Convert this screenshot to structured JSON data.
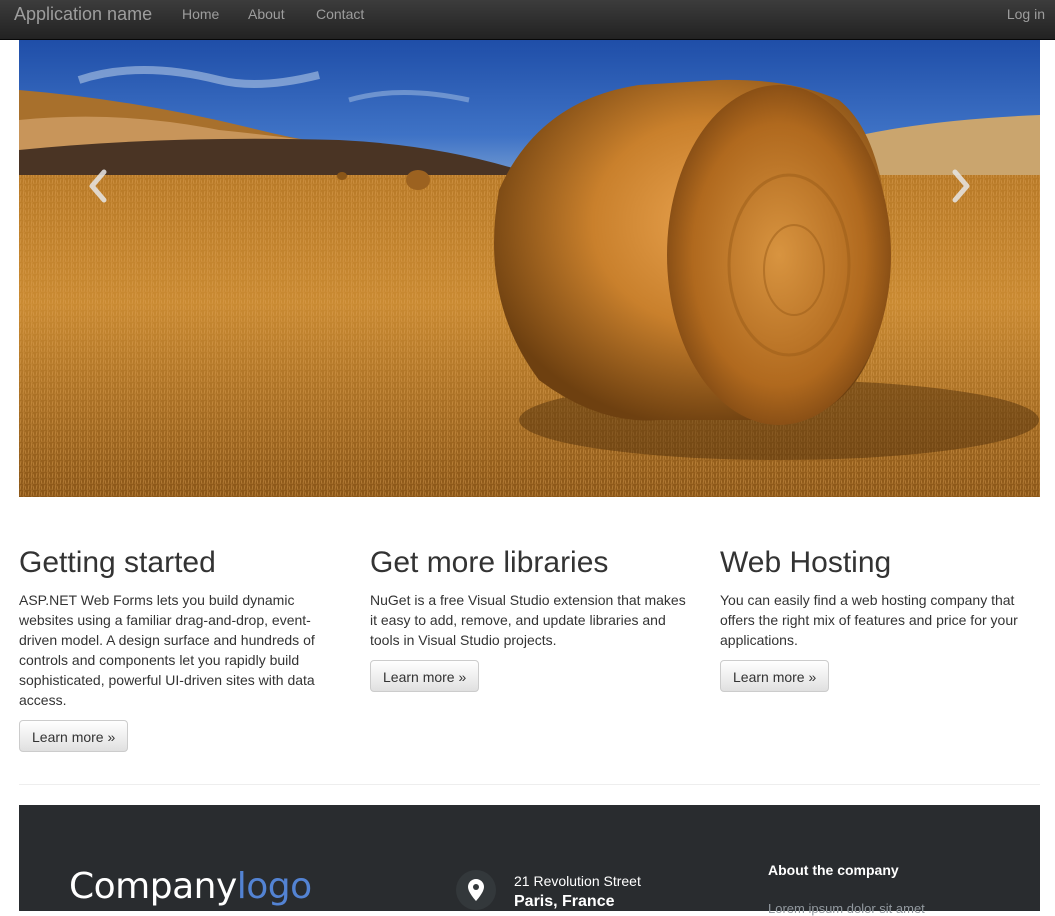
{
  "navbar": {
    "brand": "Application name",
    "links": [
      "Home",
      "About",
      "Contact"
    ],
    "login": "Log in"
  },
  "carousel": {
    "prev_icon": "chevron-left-icon",
    "next_icon": "chevron-right-icon",
    "slide": "hay bale in harvested field"
  },
  "columns": [
    {
      "title": "Getting started",
      "text": "ASP.NET Web Forms lets you build dynamic websites using a familiar drag-and-drop, event-driven model. A design surface and hundreds of controls and components let you rapidly build sophisticated, powerful UI-driven sites with data access.",
      "button": "Learn more »"
    },
    {
      "title": "Get more libraries",
      "text": "NuGet is a free Visual Studio extension that makes it easy to add, remove, and update libraries and tools in Visual Studio projects.",
      "button": "Learn more »"
    },
    {
      "title": "Web Hosting",
      "text": "You can easily find a web hosting company that offers the right mix of features and price for your applications.",
      "button": "Learn more »"
    }
  ],
  "footer": {
    "logo_main": "Company",
    "logo_accent": "logo",
    "address_icon": "map-pin-icon",
    "street": "21 Revolution Street",
    "city": "Paris, France",
    "about_title": "About the company",
    "about_text": "Lorem ipsum dolor sit amet"
  },
  "colors": {
    "navbar": "#222222",
    "footer": "#292c2f",
    "logo_accent": "#5383d3"
  }
}
